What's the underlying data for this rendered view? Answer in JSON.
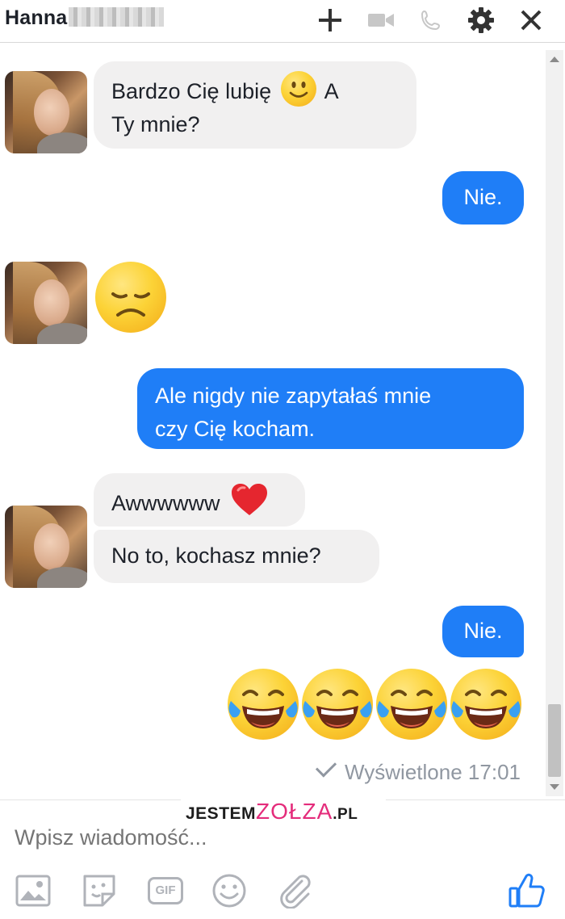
{
  "header": {
    "contact_name": "Hanna",
    "icons": [
      "plus-icon",
      "video-camera-icon",
      "phone-icon",
      "gear-icon",
      "close-icon"
    ]
  },
  "messages": [
    {
      "from": "contact",
      "text_line1": "Bardzo Cię lubię",
      "emoji": "slightly-smiling-face",
      "text_tail": "A",
      "text_line2": "Ty mnie?"
    },
    {
      "from": "me",
      "text": "Nie."
    },
    {
      "from": "contact",
      "emoji": "disappointed-face"
    },
    {
      "from": "me",
      "text_line1": "Ale nigdy nie zapytałaś mnie",
      "text_line2": "czy Cię kocham."
    },
    {
      "from": "contact",
      "text": "Awwwwww",
      "emoji": "red-heart"
    },
    {
      "from": "contact",
      "text": "No to, kochasz mnie?"
    },
    {
      "from": "me",
      "text": "Nie."
    },
    {
      "from": "me",
      "emoji": "face-with-tears-of-joy",
      "count": 4
    }
  ],
  "status": {
    "seen_label": "Wyświetlone",
    "time": "17:01"
  },
  "watermark": {
    "prefix": "JESTEM",
    "middle": "ZOŁZA",
    "suffix": ".PL"
  },
  "composer": {
    "placeholder": "Wpisz wiadomość...",
    "tools": [
      "image-icon",
      "sticker-icon",
      "gif-icon",
      "emoji-icon",
      "attachment-icon"
    ],
    "gif_label": "GIF",
    "send_icon": "thumbs-up-icon"
  },
  "colors": {
    "outgoing_bubble": "#1f7ef7",
    "incoming_bubble": "#f1f0f0",
    "like_button": "#1f7ef7"
  }
}
